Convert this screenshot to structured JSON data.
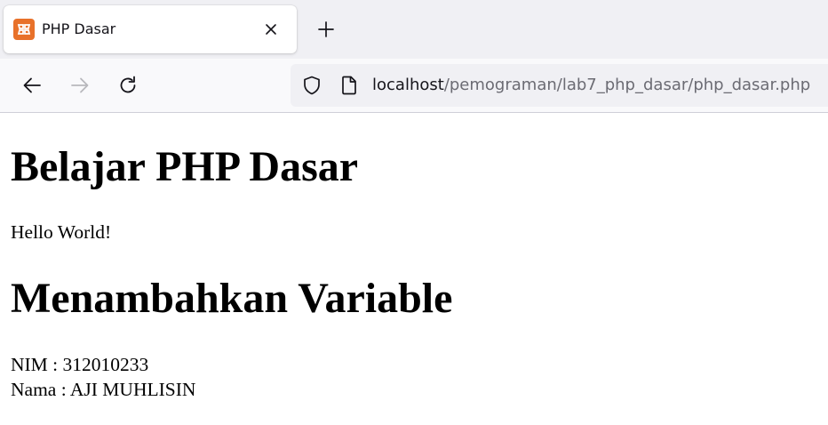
{
  "browser": {
    "tab": {
      "title": "PHP Dasar",
      "favicon": "xampp-icon",
      "favicon_color": "#e8712a"
    },
    "toolbar": {
      "back_icon": "arrow-left-icon",
      "forward_icon": "arrow-right-icon",
      "reload_icon": "reload-icon",
      "new_tab_icon": "plus-icon",
      "close_tab_icon": "close-icon"
    },
    "urlbar": {
      "host": "localhost",
      "path": "/pemograman/lab7_php_dasar/php_dasar.php",
      "shield_icon": "shield-icon",
      "page_icon": "page-icon"
    }
  },
  "page": {
    "heading1": "Belajar PHP Dasar",
    "hello": "Hello World!",
    "heading2": "Menambahkan Variable",
    "nim": "NIM : 312010233",
    "nama": "Nama : AJI MUHLISIN"
  }
}
